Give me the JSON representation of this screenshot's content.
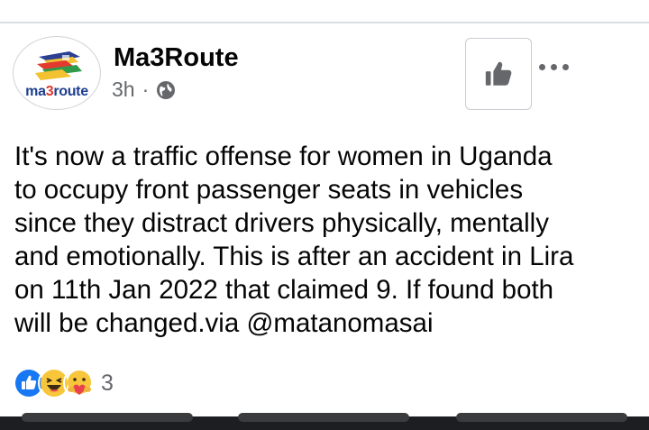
{
  "post": {
    "author": "Ma3Route",
    "avatar_text_pre": "ma",
    "avatar_text_three": "3",
    "avatar_text_post": "route",
    "time": "3h",
    "separator": "·",
    "audience_icon": "globe-icon",
    "like_icon": "thumbs-up-icon",
    "more_icon": "more-options-icon",
    "text_lines": [
      "It's now a traffic offense for women in Uganda",
      "to occupy front passenger seats in vehicles",
      "since they distract drivers physically, mentally",
      "and emotionally. This is after an accident in Lira",
      "on 11th Jan 2022 that claimed 9. If found both",
      "will be changed.via @matanomasai"
    ]
  },
  "reactions": {
    "types": [
      "like",
      "haha",
      "care"
    ],
    "count": "3"
  },
  "colors": {
    "like_blue": "#1877f2",
    "emoji_yellow": "#f7c63b",
    "meta_gray": "#65676b"
  }
}
